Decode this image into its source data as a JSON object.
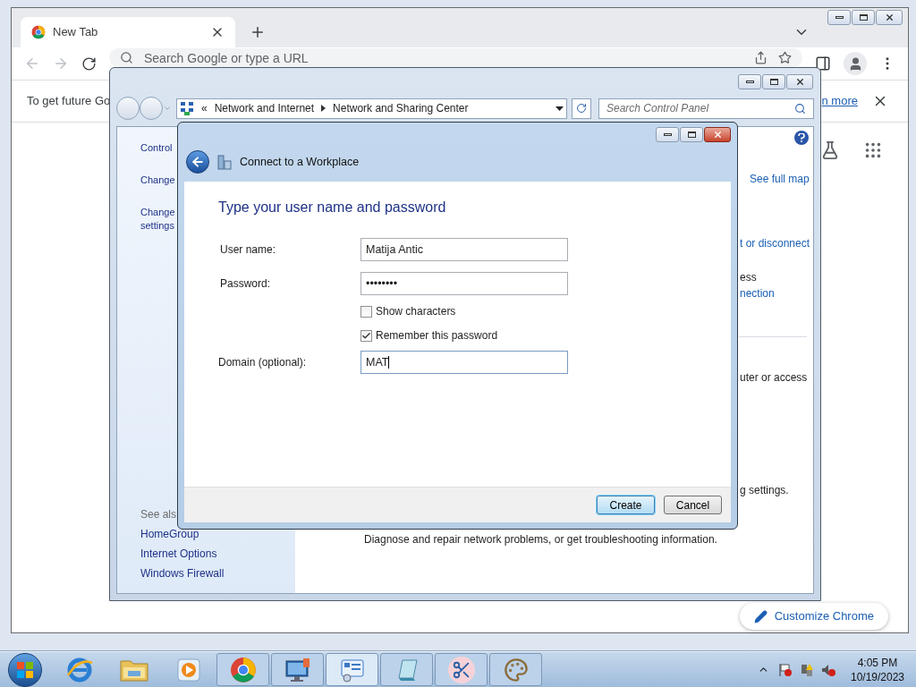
{
  "browser": {
    "tabs": [
      {
        "label": "New Tab",
        "selected": true
      }
    ],
    "omnibox": {
      "placeholder": "Search Google or type a URL"
    },
    "infobar": {
      "text": "To get future Go",
      "link": "n more"
    },
    "customize_button": "Customize Chrome"
  },
  "control_panel": {
    "breadcrumb_prefix": "«",
    "breadcrumb": [
      "Network and Internet",
      "Network and Sharing Center"
    ],
    "search": {
      "placeholder": "Search Control Panel"
    },
    "tasks": [
      "Control",
      "Change",
      "Change settings"
    ],
    "see_also_heading": "See als",
    "see_also": [
      "HomeGroup",
      "Internet Options",
      "Windows Firewall"
    ],
    "fragments": [
      {
        "text": "See full map",
        "kind": "link"
      },
      {
        "text": "t or disconnect",
        "kind": "link"
      },
      {
        "text": "ess",
        "kind": "text"
      },
      {
        "text": "nection",
        "kind": "link"
      },
      {
        "text": "uter or access",
        "kind": "text"
      },
      {
        "text": "g settings.",
        "kind": "text"
      },
      {
        "text": "Diagnose and repair network problems, or get troubleshooting information.",
        "kind": "text"
      }
    ]
  },
  "dialog": {
    "title": "Connect to a Workplace",
    "heading": "Type your user name and password",
    "fields": [
      {
        "label": "User name:",
        "value": "Matija Antic"
      },
      {
        "label": "Password:",
        "value": "••••••••"
      }
    ],
    "checkboxes": [
      {
        "label": "Show characters",
        "checked": false
      },
      {
        "label": "Remember this password",
        "checked": true
      }
    ],
    "domain": {
      "label": "Domain (optional):",
      "value": "MAT",
      "focused": true
    },
    "buttons": [
      {
        "label": "Create",
        "default": true
      },
      {
        "label": "Cancel",
        "default": false
      }
    ]
  },
  "taskbar": {
    "apps": [
      {
        "kind": "ie",
        "open": false,
        "active": false
      },
      {
        "kind": "explorer",
        "open": false,
        "active": false
      },
      {
        "kind": "media",
        "open": false,
        "active": false
      },
      {
        "kind": "chrome",
        "open": true,
        "active": false
      },
      {
        "kind": "remote",
        "open": true,
        "active": false
      },
      {
        "kind": "control-panel",
        "open": true,
        "active": true
      },
      {
        "kind": "notepad",
        "open": true,
        "active": false
      },
      {
        "kind": "snipping",
        "open": true,
        "active": false
      },
      {
        "kind": "paint",
        "open": true,
        "active": false
      }
    ],
    "clock": {
      "time": "4:05 PM",
      "date": "10/19/2023"
    }
  }
}
